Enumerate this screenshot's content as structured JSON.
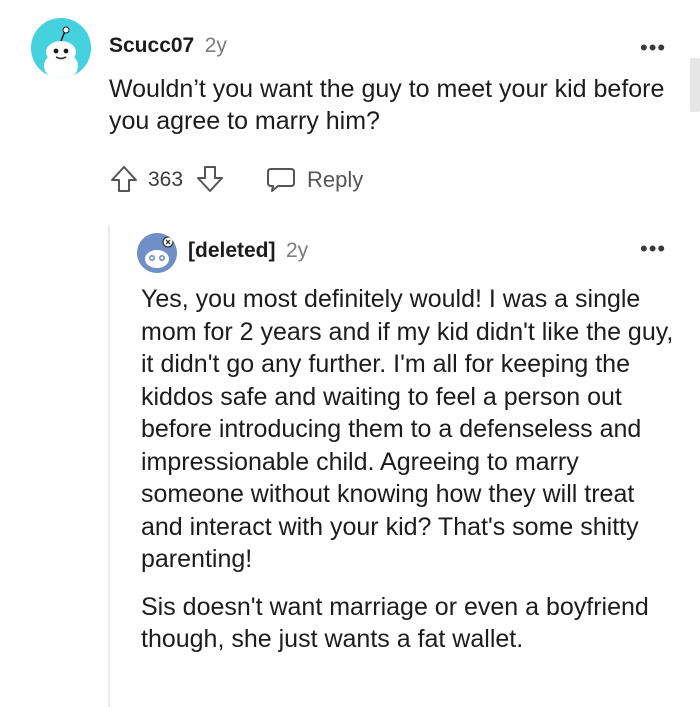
{
  "comment": {
    "username": "Scucc07",
    "age": "2y",
    "body": "Wouldn’t you want the guy to meet your kid before you agree to marry him?",
    "score": "363",
    "reply_label": "Reply",
    "more_label": "•••"
  },
  "reply": {
    "username": "[deleted]",
    "age": "2y",
    "more_label": "•••",
    "paragraphs": [
      "Yes, you most definitely would! I was a single mom for 2 years and if my kid didn't like the guy, it didn't go any further. I'm all for keeping the kiddos safe and waiting to feel a person out before introducing them to a defenseless and impressionable child. Agreeing to marry someone without knowing how they will treat and interact with your kid? That's some shitty parenting!",
      "Sis doesn't want marriage or even a boyfriend though, she just wants a fat wallet."
    ]
  },
  "colors": {
    "avatar_bg": "#46d1de",
    "reply_avatar_bg": "#6f8fc7",
    "muted": "#7c7c7c"
  },
  "icons": [
    "snoo-avatar-icon",
    "upvote-icon",
    "downvote-icon",
    "comment-icon",
    "overflow-menu-icon",
    "deleted-user-avatar-icon"
  ]
}
